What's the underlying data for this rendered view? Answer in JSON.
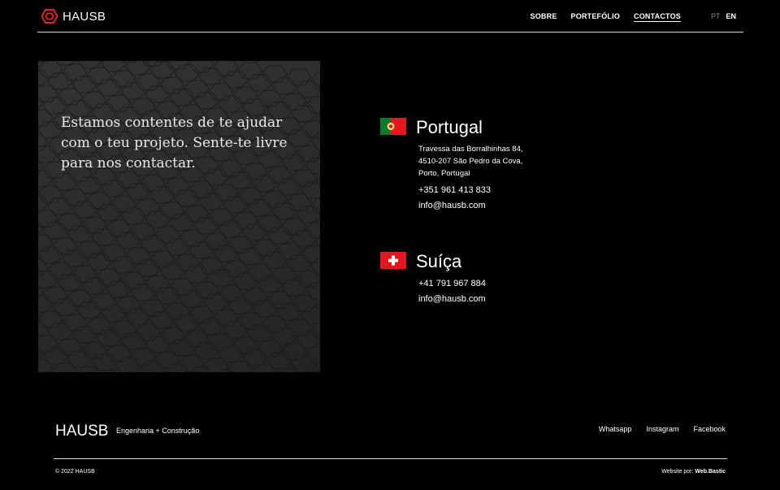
{
  "header": {
    "brand": "HAUSB",
    "nav": [
      {
        "label": "SOBRE",
        "active": false
      },
      {
        "label": "PORTEFÓLIO",
        "active": false
      },
      {
        "label": "CONTACTOS",
        "active": true
      }
    ],
    "languages": [
      {
        "label": "PT",
        "active": false
      },
      {
        "label": "EN",
        "active": true
      }
    ],
    "accent": "#e8242a"
  },
  "hero": {
    "text": "Estamos contentes de te ajudar com o teu projeto. Sente-te livre para nos contactar."
  },
  "contacts": {
    "portugal": {
      "name": "Portugal",
      "address": [
        "Travessa das Borralhinhas 84,",
        "4510-207 São Pedro da Cova,",
        "Porto, Portugal"
      ],
      "phone": "+351 961 413 833",
      "email": "info@hausb.com",
      "flag_icon": "portugal-flag-icon"
    },
    "switzerland": {
      "name": "Suíça",
      "phone": "+41 791 967 884",
      "email": "info@hausb.com",
      "flag_icon": "switzerland-flag-icon"
    }
  },
  "footer": {
    "brand": "HAUSB",
    "tagline": "Engenharia + Construção",
    "links": [
      "Whatsapp",
      "Instagram",
      "Facebook"
    ],
    "copyright": "© 2022 HAUSB",
    "credit_prefix": "Website por:",
    "credit_name": "Web.Bastic"
  }
}
